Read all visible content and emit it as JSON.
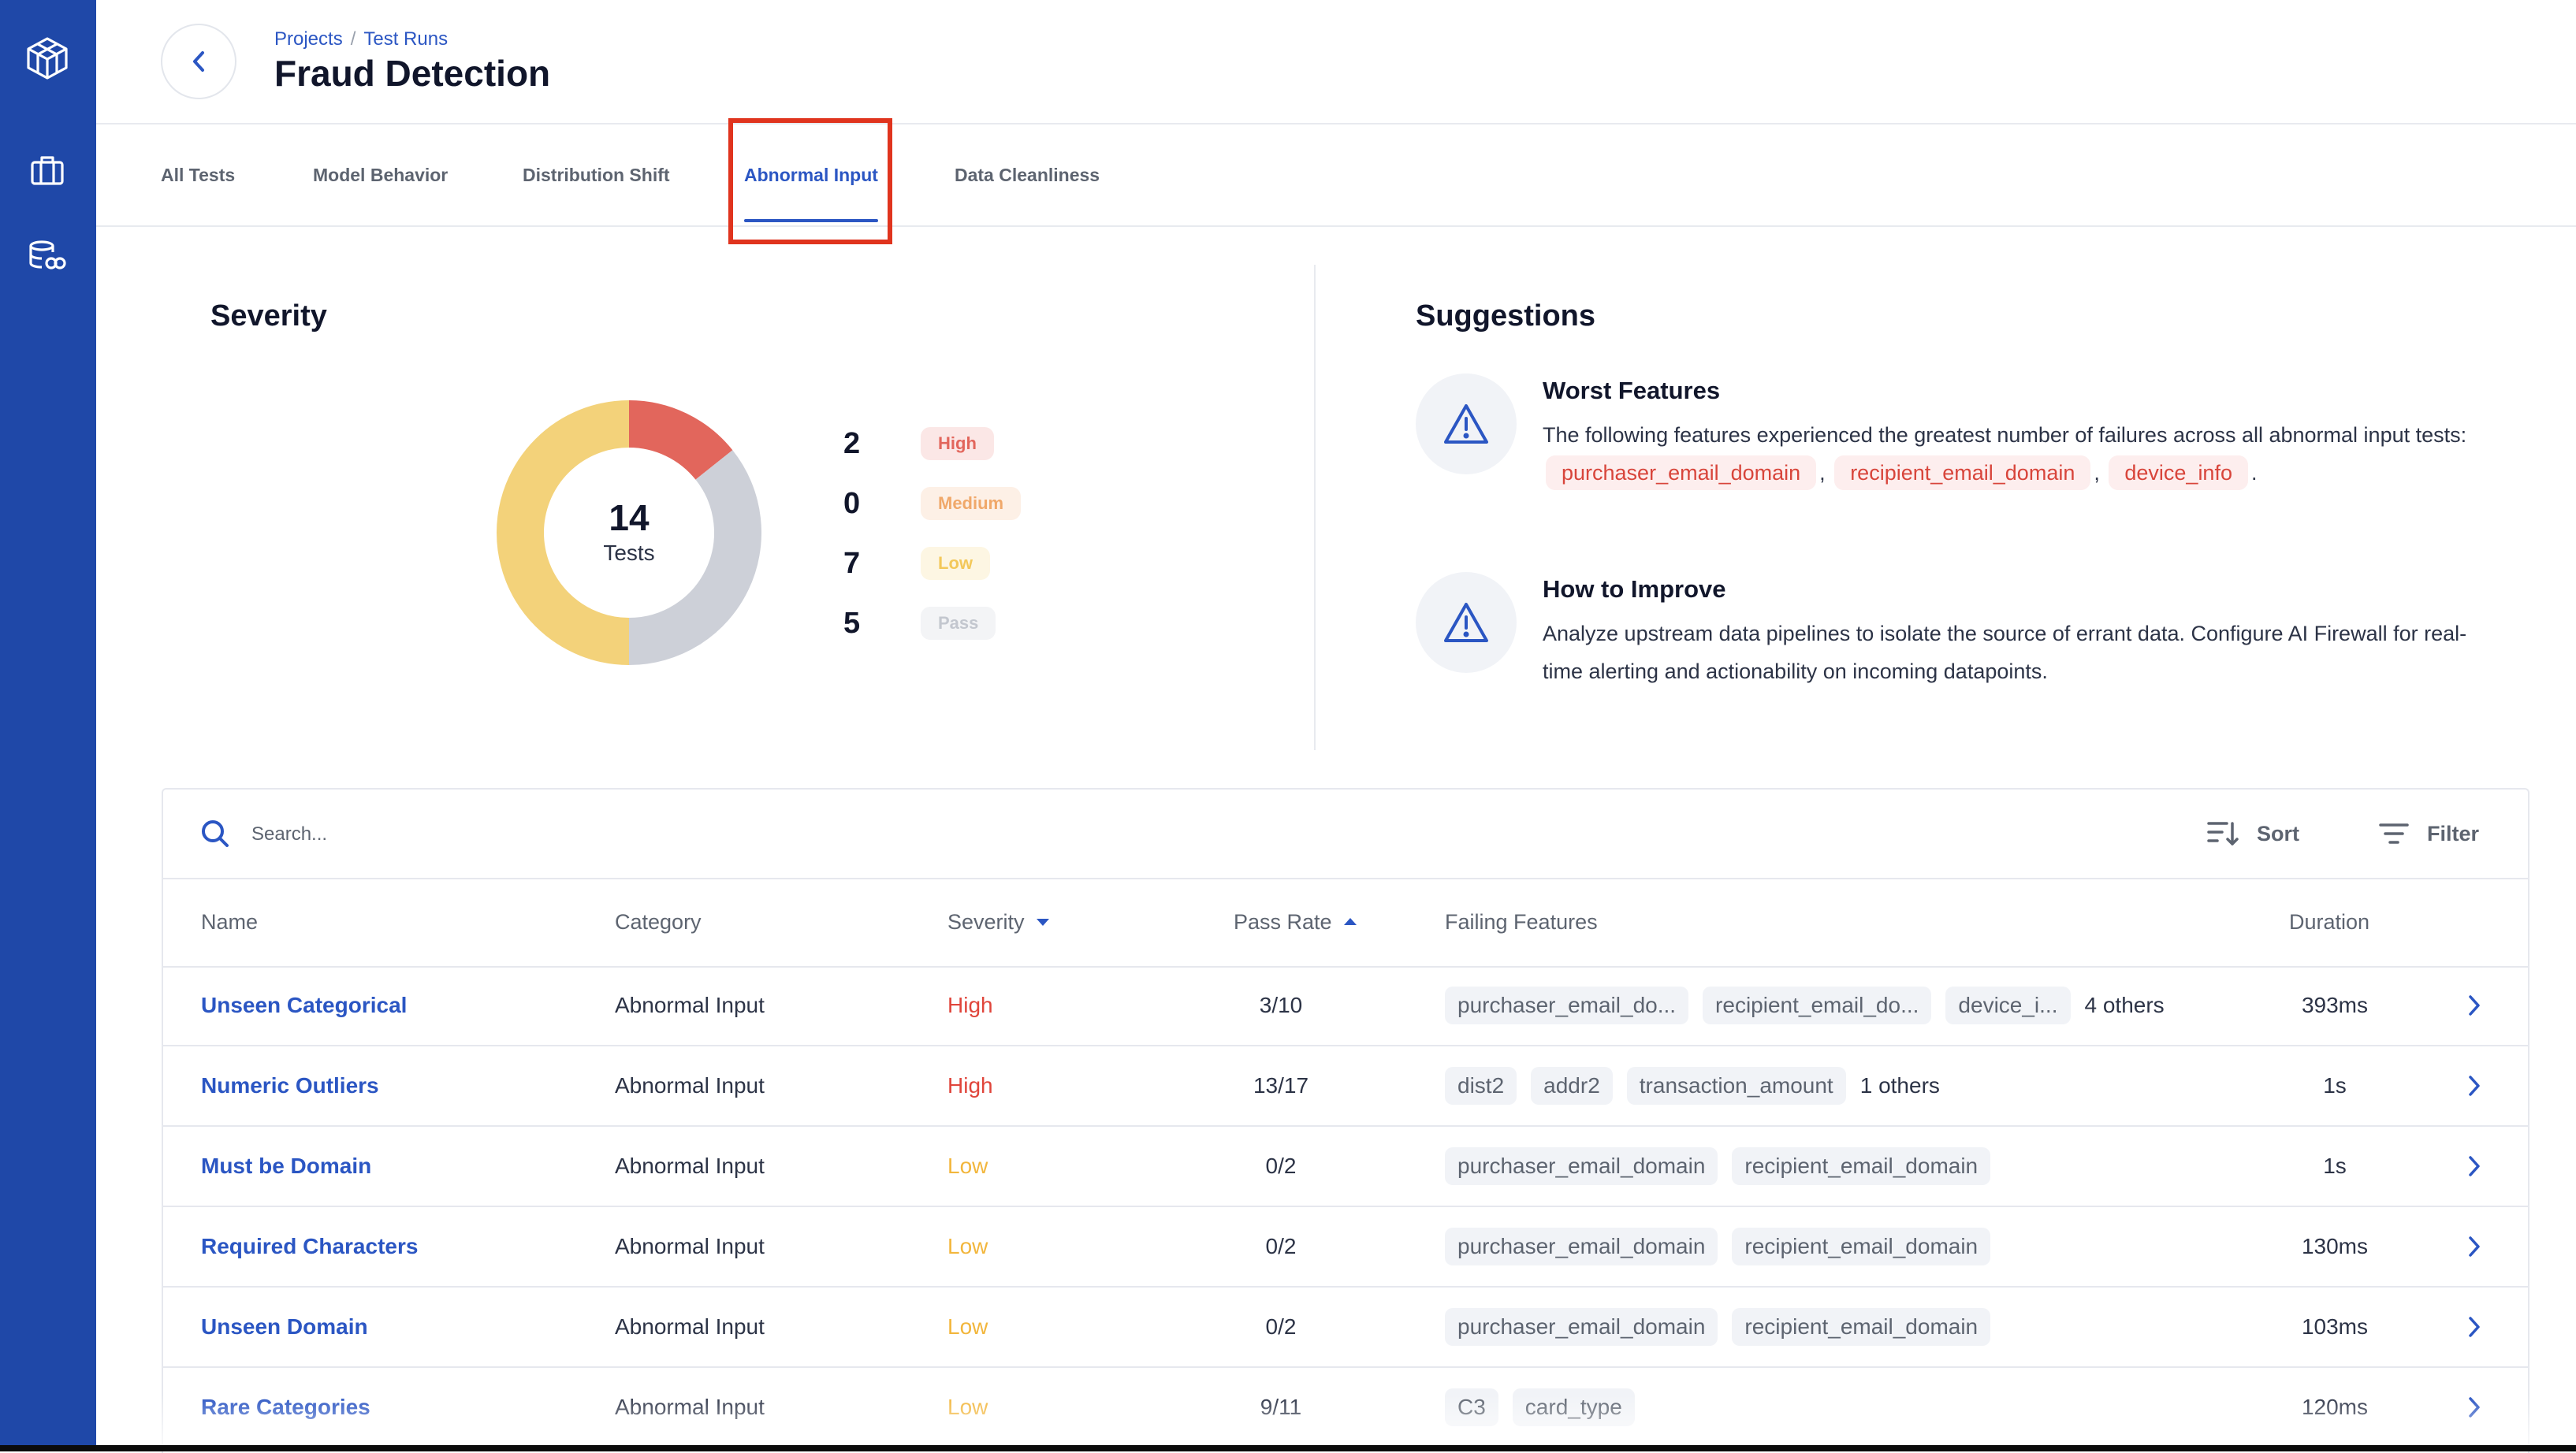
{
  "nav": {
    "items": [
      {
        "icon": "logo-icon"
      },
      {
        "icon": "briefcase-icon"
      },
      {
        "icon": "database-link-icon"
      }
    ]
  },
  "header": {
    "breadcrumb": [
      "Projects",
      "Test Runs"
    ],
    "title": "Fraud Detection"
  },
  "tabs": [
    "All Tests",
    "Model Behavior",
    "Distribution Shift",
    "Abnormal Input",
    "Data Cleanliness"
  ],
  "active_tab": "Abnormal Input",
  "severity": {
    "title": "Severity",
    "total": "14",
    "total_label": "Tests",
    "levels": [
      {
        "count": "2",
        "label": "High",
        "color": "#e2665c",
        "badge_bg": "#fbe7e6"
      },
      {
        "count": "0",
        "label": "Medium",
        "color": "#f0a86a",
        "badge_bg": "#fdf0e6"
      },
      {
        "count": "7",
        "label": "Low",
        "color": "#f3d27a",
        "badge_bg": "#fdf6e3"
      },
      {
        "count": "5",
        "label": "Pass",
        "color": "#cdd0d8",
        "badge_bg": "#f3f4f6"
      }
    ]
  },
  "suggestions": {
    "title": "Suggestions",
    "items": [
      {
        "heading": "Worst Features",
        "text_before": "The following features experienced the greatest number of failures across all abnormal input tests:",
        "features": [
          "purchaser_email_domain",
          "recipient_email_domain",
          "device_info"
        ],
        "text_after": "."
      },
      {
        "heading": "How to Improve",
        "text": "Analyze upstream data pipelines to isolate the source of errant data. Configure AI Firewall for real-time alerting and actionability on incoming datapoints."
      }
    ]
  },
  "table": {
    "search_placeholder": "Search...",
    "sort_label": "Sort",
    "filter_label": "Filter",
    "columns": [
      "Name",
      "Category",
      "Severity",
      "Pass Rate",
      "Failing Features",
      "Duration"
    ],
    "rows": [
      {
        "name": "Unseen Categorical",
        "category": "Abnormal Input",
        "severity": "High",
        "pass_rate": "3/10",
        "features": [
          "purchaser_email_do...",
          "recipient_email_do...",
          "device_i..."
        ],
        "others": "4 others",
        "duration": "393ms"
      },
      {
        "name": "Numeric Outliers",
        "category": "Abnormal Input",
        "severity": "High",
        "pass_rate": "13/17",
        "features": [
          "dist2",
          "addr2",
          "transaction_amount"
        ],
        "others": "1 others",
        "duration": "1s"
      },
      {
        "name": "Must be Domain",
        "category": "Abnormal Input",
        "severity": "Low",
        "pass_rate": "0/2",
        "features": [
          "purchaser_email_domain",
          "recipient_email_domain"
        ],
        "others": "",
        "duration": "1s"
      },
      {
        "name": "Required Characters",
        "category": "Abnormal Input",
        "severity": "Low",
        "pass_rate": "0/2",
        "features": [
          "purchaser_email_domain",
          "recipient_email_domain"
        ],
        "others": "",
        "duration": "130ms"
      },
      {
        "name": "Unseen Domain",
        "category": "Abnormal Input",
        "severity": "Low",
        "pass_rate": "0/2",
        "features": [
          "purchaser_email_domain",
          "recipient_email_domain"
        ],
        "others": "",
        "duration": "103ms"
      },
      {
        "name": "Rare Categories",
        "category": "Abnormal Input",
        "severity": "Low",
        "pass_rate": "9/11",
        "features": [
          "C3",
          "card_type"
        ],
        "others": "",
        "duration": "120ms"
      }
    ]
  },
  "colors": {
    "accent": "#2b56c3",
    "rail": "#1f48a8",
    "high": "#e0453b",
    "low": "#f2b63c"
  }
}
